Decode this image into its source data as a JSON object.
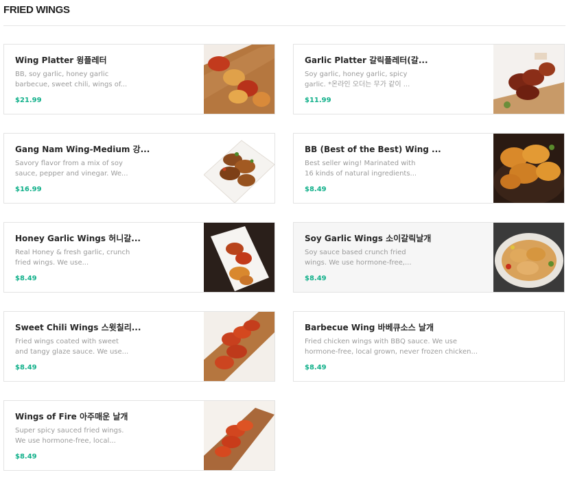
{
  "section_title": "FRIED WINGS",
  "items": [
    {
      "name": "Wing Platter 윙플레터",
      "desc": "BB, soy garlic, honey garlic barbecue, sweet chili, wings of...",
      "price": "$21.99",
      "image": "wing-platter-photo"
    },
    {
      "name": "Garlic Platter 갈릭플레터(갈...",
      "desc": "Soy garlic, honey garlic, spicy garlic. *온라인 오더는 무가 같이 ...",
      "price": "$11.99",
      "image": "garlic-platter-photo"
    },
    {
      "name": "Gang Nam Wing-Medium 강...",
      "desc": "Savory flavor from a mix of soy sauce, pepper and vinegar. We...",
      "price": "$16.99",
      "image": "gang-nam-wing-photo"
    },
    {
      "name": "BB (Best of the Best) Wing ...",
      "desc": "Best seller wing! Marinated with 16 kinds of natural ingredients...",
      "price": "$8.49",
      "image": "bb-wing-photo"
    },
    {
      "name": "Honey Garlic Wings 허니갈...",
      "desc": "Real Honey & fresh garlic, crunch fried wings. We use...",
      "price": "$8.49",
      "image": "honey-garlic-wings-photo"
    },
    {
      "name": "Soy Garlic Wings 소이갈릭날개",
      "desc": "Soy sauce based crunch fried wings. We use hormone-free,...",
      "price": "$8.49",
      "image": "soy-garlic-wings-photo"
    },
    {
      "name": "Sweet Chili Wings 스윗칠리...",
      "desc": "Fried wings coated with sweet and tangy glaze sauce. We use...",
      "price": "$8.49",
      "image": "sweet-chili-wings-photo"
    },
    {
      "name": "Barbecue Wing 바베큐소스 날개",
      "desc": "Fried chicken wings with BBQ sauce. We use hormone-free, local grown, never frozen chicken...",
      "price": "$8.49",
      "image": null
    },
    {
      "name": "Wings of Fire 아주매운 날개",
      "desc": "Super spicy sauced fried wings. We use hormone-free, local...",
      "price": "$8.49",
      "image": "wings-of-fire-photo"
    }
  ]
}
